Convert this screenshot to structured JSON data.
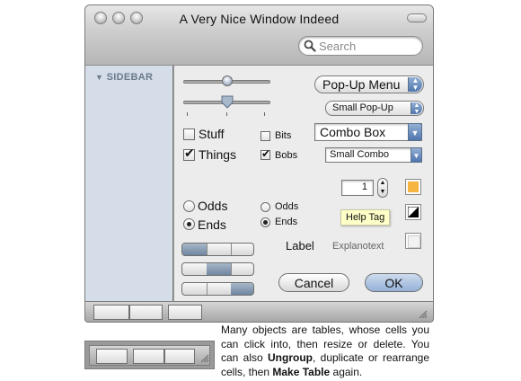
{
  "window": {
    "title": "A Very Nice Window Indeed",
    "search_placeholder": "Search"
  },
  "sidebar": {
    "heading": "SIDEBAR"
  },
  "controls": {
    "slider1_value": 0.5,
    "slider2_value": 0.5,
    "popup_menu": "Pop-Up Menu",
    "small_popup": "Small Pop-Up",
    "combo_box": "Combo Box",
    "small_combo": "Small Combo",
    "checkbox_stuff": {
      "label": "Stuff",
      "checked": false
    },
    "checkbox_things": {
      "label": "Things",
      "checked": true
    },
    "checkbox_bits": {
      "label": "Bits",
      "checked": false
    },
    "checkbox_bobs": {
      "label": "Bobs",
      "checked": true
    },
    "radio_odds": "Odds",
    "radio_ends": "Ends",
    "radio_odds_small": "Odds",
    "radio_ends_small": "Ends",
    "selected_radio": "Ends",
    "stepper_value": "1",
    "help_tag": "Help Tag",
    "label": "Label",
    "explanotext": "Explanotext",
    "cancel_label": "Cancel",
    "ok_label": "OK"
  },
  "colors": {
    "sidebar_bg": "#d4dde8",
    "well_orange": "#f5b540",
    "accent_blue": "#4f76ae"
  },
  "caption": {
    "part1": "Many objects are tables, whose cells you can click into, then resize or delete. You can also ",
    "ungroup": "Ungroup",
    "part2": ", duplicate or rearrange cells, then ",
    "make_table": "Make Table",
    "part3": " again."
  }
}
